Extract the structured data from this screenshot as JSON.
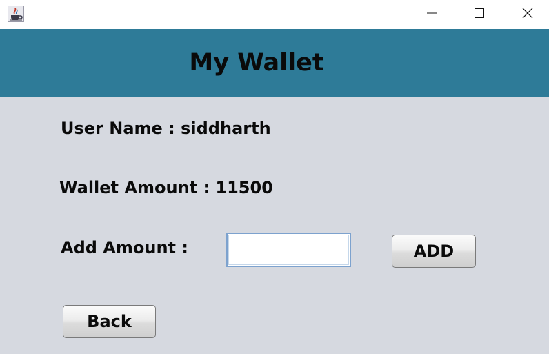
{
  "window": {
    "icon": "java-cup-icon",
    "controls": {
      "minimize": "minimize-icon",
      "maximize": "maximize-icon",
      "close": "close-icon"
    }
  },
  "header": {
    "title": "My Wallet",
    "background": "#2e7b98"
  },
  "content": {
    "user_name_label": "User Name : siddharth",
    "wallet_amount_label": "Wallet Amount : 11500",
    "add_amount_label": "Add Amount :",
    "amount_input_value": "",
    "add_button_label": "ADD",
    "back_button_label": "Back",
    "background": "#d6d9e0"
  }
}
